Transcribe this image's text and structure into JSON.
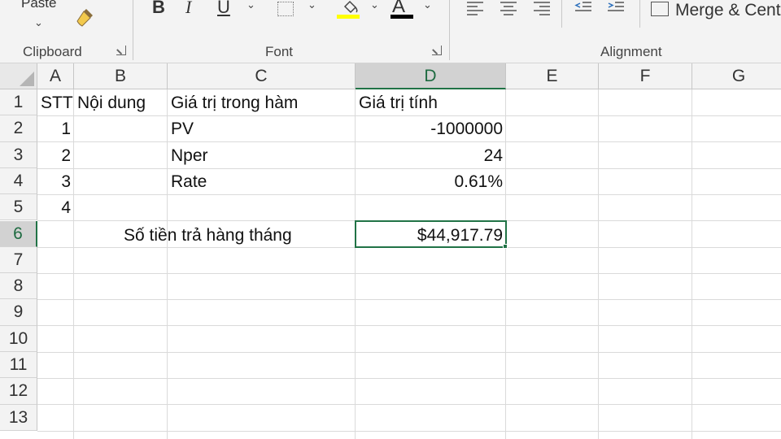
{
  "ribbon": {
    "clipboard": {
      "paste_label": "Paste",
      "group_label": "Clipboard"
    },
    "font": {
      "group_label": "Font",
      "bold": "B",
      "italic": "I",
      "underline": "U",
      "font_color_letter": "A",
      "fill_color": "#ffff00",
      "font_color": "#000000"
    },
    "alignment": {
      "group_label": "Alignment",
      "merge_label": "Merge & Cent"
    }
  },
  "columns": [
    "A",
    "B",
    "C",
    "D",
    "E",
    "F",
    "G"
  ],
  "rows": [
    "1",
    "2",
    "3",
    "4",
    "5",
    "6",
    "7",
    "8",
    "9",
    "10",
    "11",
    "12",
    "13"
  ],
  "selection": {
    "column": "D",
    "row": "6",
    "accent": "#217346"
  },
  "cells": {
    "A1": "STT",
    "B1": "Nội dung",
    "C1": "Giá trị trong hàm",
    "D1": "Giá trị tính",
    "A2": "1",
    "C2": "PV",
    "D2": "-1000000",
    "A3": "2",
    "C3": "Nper",
    "D3": "24",
    "A4": "3",
    "C4": "Rate",
    "D4": "0.61%",
    "A5": "4",
    "B6": "Số tiền trả hàng tháng",
    "D6": "$44,917.79"
  }
}
